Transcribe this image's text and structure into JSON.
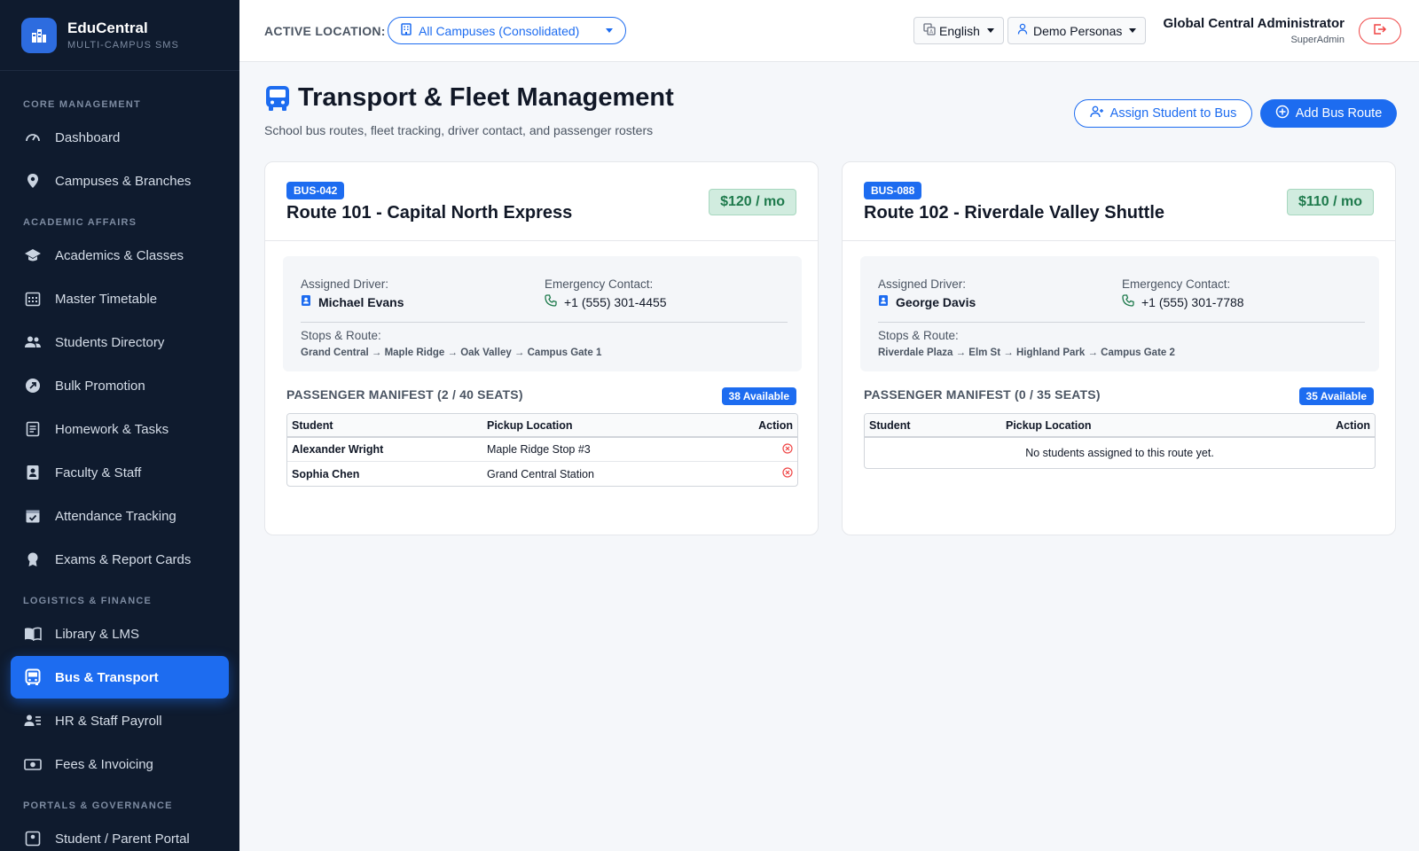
{
  "app": {
    "name": "EduCentral",
    "subtitle": "MULTI-CAMPUS SMS"
  },
  "sidebar": {
    "sections": [
      {
        "title": "CORE MANAGEMENT",
        "items": [
          {
            "label": "Dashboard",
            "icon": "dashboard-icon"
          },
          {
            "label": "Campuses & Branches",
            "icon": "map-pin-icon"
          }
        ]
      },
      {
        "title": "ACADEMIC AFFAIRS",
        "items": [
          {
            "label": "Academics & Classes",
            "icon": "graduation-cap-icon"
          },
          {
            "label": "Master Timetable",
            "icon": "calendar-grid-icon"
          },
          {
            "label": "Students Directory",
            "icon": "people-icon"
          },
          {
            "label": "Bulk Promotion",
            "icon": "arrow-up-right-icon"
          },
          {
            "label": "Homework & Tasks",
            "icon": "document-list-icon"
          },
          {
            "label": "Faculty & Staff",
            "icon": "id-badge-icon"
          },
          {
            "label": "Attendance Tracking",
            "icon": "calendar-check-icon"
          },
          {
            "label": "Exams & Report Cards",
            "icon": "award-icon"
          }
        ]
      },
      {
        "title": "LOGISTICS & FINANCE",
        "items": [
          {
            "label": "Library & LMS",
            "icon": "book-icon"
          },
          {
            "label": "Bus & Transport",
            "icon": "bus-icon",
            "active": true
          },
          {
            "label": "HR & Staff Payroll",
            "icon": "person-lines-icon"
          },
          {
            "label": "Fees & Invoicing",
            "icon": "cash-icon"
          }
        ]
      },
      {
        "title": "PORTALS & GOVERNANCE",
        "items": [
          {
            "label": "Student / Parent Portal",
            "icon": "portal-icon"
          }
        ]
      }
    ]
  },
  "topbar": {
    "location_label": "ACTIVE LOCATION:",
    "location_value": "All Campuses (Consolidated)",
    "language": "English",
    "personas": "Demo Personas",
    "user_name": "Global Central Administrator",
    "user_role": "SuperAdmin"
  },
  "page": {
    "title": "Transport & Fleet Management",
    "subtitle": "School bus routes, fleet tracking, driver contact, and passenger rosters",
    "assign_button": "Assign Student to Bus",
    "add_button": "Add Bus Route"
  },
  "routes": [
    {
      "bus_id": "BUS-042",
      "name": "Route 101 - Capital North Express",
      "fee": "$120 / mo",
      "driver_label": "Assigned Driver:",
      "driver": "Michael Evans",
      "contact_label": "Emergency Contact:",
      "contact": "+1 (555) 301-4455",
      "stops_label": "Stops & Route:",
      "stops": "Grand Central → Maple Ridge → Oak Valley → Campus Gate 1",
      "manifest_title": "PASSENGER MANIFEST (2 / 40 SEATS)",
      "available": "38 Available",
      "columns": [
        "Student",
        "Pickup Location",
        "Action"
      ],
      "passengers": [
        {
          "student": "Alexander Wright",
          "pickup": "Maple Ridge Stop #3"
        },
        {
          "student": "Sophia Chen",
          "pickup": "Grand Central Station"
        }
      ],
      "empty_text": ""
    },
    {
      "bus_id": "BUS-088",
      "name": "Route 102 - Riverdale Valley Shuttle",
      "fee": "$110 / mo",
      "driver_label": "Assigned Driver:",
      "driver": "George Davis",
      "contact_label": "Emergency Contact:",
      "contact": "+1 (555) 301-7788",
      "stops_label": "Stops & Route:",
      "stops": "Riverdale Plaza → Elm St → Highland Park → Campus Gate 2",
      "manifest_title": "PASSENGER MANIFEST (0 / 35 SEATS)",
      "available": "35 Available",
      "columns": [
        "Student",
        "Pickup Location",
        "Action"
      ],
      "passengers": [],
      "empty_text": "No students assigned to this route yet."
    }
  ],
  "colors": {
    "accent": "#1d6cf0",
    "sidebar_bg": "#0f1b2e",
    "fee_green": "#1e7a4c",
    "danger": "#ef4444"
  }
}
